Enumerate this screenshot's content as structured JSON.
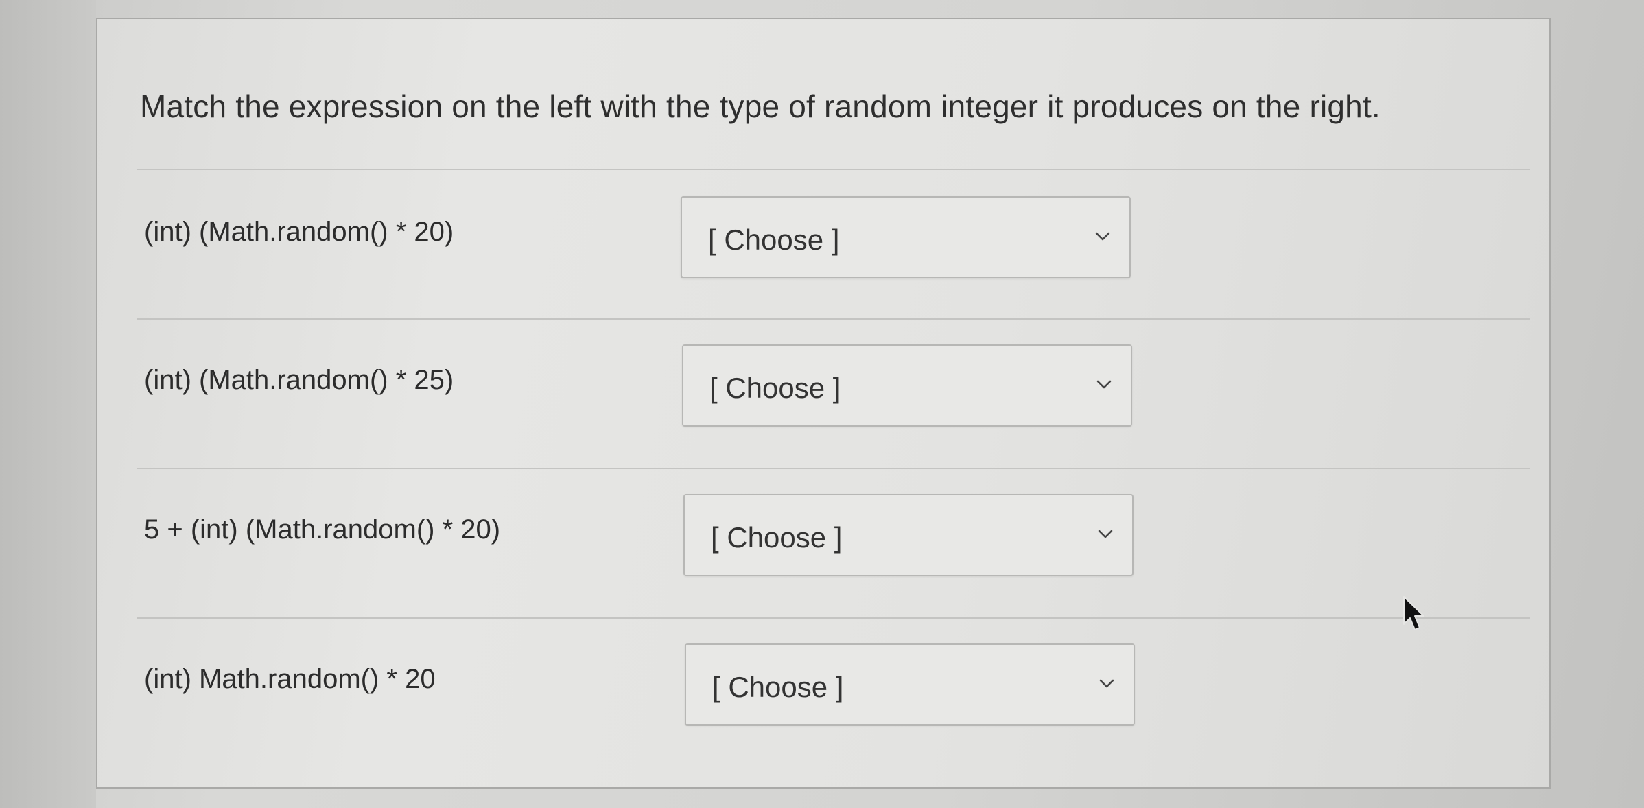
{
  "question": {
    "text": "Match the expression on the left with the type of random integer it produces on the right."
  },
  "rows": [
    {
      "prompt": "(int) (Math.random() * 20)",
      "selected": "[ Choose ]"
    },
    {
      "prompt": "(int) (Math.random() * 25)",
      "selected": "[ Choose ]"
    },
    {
      "prompt": "5 + (int) (Math.random() * 20)",
      "selected": "[ Choose ]"
    },
    {
      "prompt": "(int) Math.random() * 20",
      "selected": "[ Choose ]"
    }
  ],
  "icons": {
    "dropdown": "chevron-down-icon",
    "pointer": "mouse-cursor-icon"
  },
  "colors": {
    "text": "#2e2e2e",
    "border": "#b7b7b5",
    "card_background": "#e3e3e1"
  }
}
